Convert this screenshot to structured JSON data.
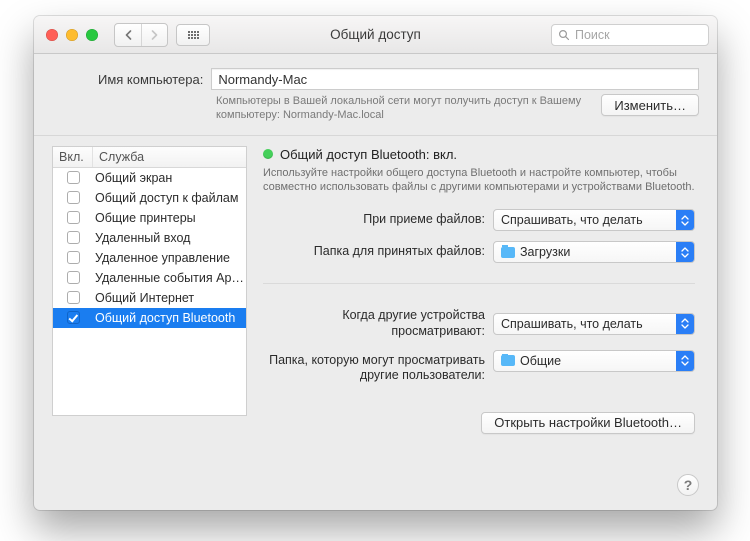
{
  "window": {
    "title": "Общий доступ"
  },
  "search": {
    "placeholder": "Поиск"
  },
  "computer_name": {
    "label": "Имя компьютера:",
    "value": "Normandy-Mac",
    "hint": "Компьютеры в Вашей локальной сети могут получить доступ к Вашему компьютеру: Normandy-Mac.local",
    "edit_btn": "Изменить…"
  },
  "services": {
    "col_on": "Вкл.",
    "col_service": "Служба",
    "items": [
      {
        "label": "Общий экран",
        "checked": false,
        "selected": false
      },
      {
        "label": "Общий доступ к файлам",
        "checked": false,
        "selected": false
      },
      {
        "label": "Общие принтеры",
        "checked": false,
        "selected": false
      },
      {
        "label": "Удаленный вход",
        "checked": false,
        "selected": false
      },
      {
        "label": "Удаленное управление",
        "checked": false,
        "selected": false
      },
      {
        "label": "Удаленные события Apple",
        "checked": false,
        "selected": false
      },
      {
        "label": "Общий Интернет",
        "checked": false,
        "selected": false
      },
      {
        "label": "Общий доступ Bluetooth",
        "checked": true,
        "selected": true
      }
    ]
  },
  "detail": {
    "status": "Общий доступ Bluetooth: вкл.",
    "description": "Используйте настройки общего доступа Bluetooth и настройте компьютер, чтобы совместно использовать файлы с другими компьютерами и устройствами Bluetooth.",
    "receive_label": "При приеме файлов:",
    "receive_value": "Спрашивать, что делать",
    "receive_folder_label": "Папка для принятых файлов:",
    "receive_folder_value": "Загрузки",
    "browse_label": "Когда другие устройства просматривают:",
    "browse_value": "Спрашивать, что делать",
    "browse_folder_label": "Папка, которую могут просматривать другие пользователи:",
    "browse_folder_value": "Общие",
    "open_prefs_btn": "Открыть настройки Bluetooth…"
  },
  "help_glyph": "?"
}
